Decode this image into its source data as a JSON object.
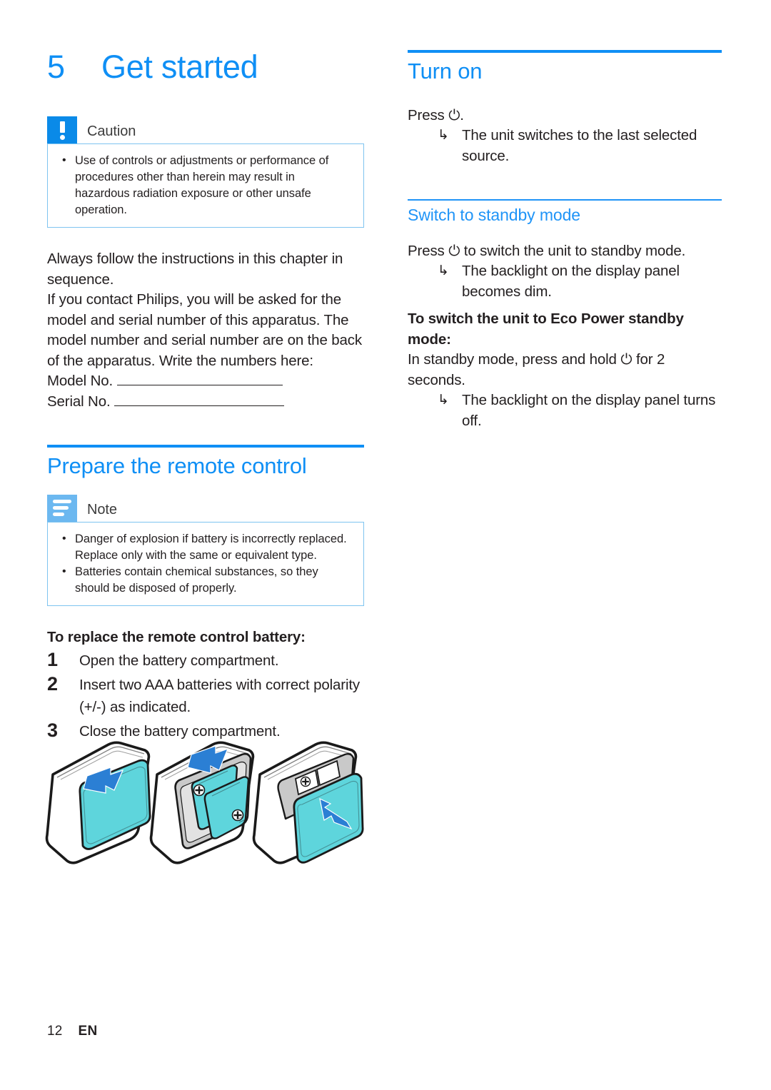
{
  "document": {
    "chapter_number": "5",
    "chapter_title": "Get started"
  },
  "left_column": {
    "caution": {
      "label": "Caution",
      "icon": "exclamation-icon",
      "items": [
        "Use of controls or adjustments or performance of procedures other than herein may result in hazardous radiation exposure or other unsafe operation."
      ]
    },
    "intro_paragraph_1": "Always follow the instructions in this chapter in sequence.",
    "intro_paragraph_2": "If you contact Philips, you will be asked for the model and serial number of this apparatus. The model number and serial number are on the back of the apparatus. Write the numbers here:",
    "model_label": "Model No.",
    "serial_label": "Serial No.",
    "prepare_section": {
      "title": "Prepare the remote control",
      "note": {
        "label": "Note",
        "icon": "note-lines-icon",
        "items": [
          "Danger of explosion if battery is incorrectly replaced. Replace only with the same or equivalent type.",
          "Batteries contain chemical substances, so they should be disposed of properly."
        ]
      },
      "steps_lead": "To replace the remote control battery:",
      "steps": [
        {
          "number": "1",
          "text": "Open the battery compartment."
        },
        {
          "number": "2",
          "text": "Insert two AAA batteries with correct polarity (+/-) as indicated."
        },
        {
          "number": "3",
          "text": "Close the battery compartment."
        }
      ],
      "figure_caption": ""
    }
  },
  "right_column": {
    "turn_on": {
      "title": "Turn on",
      "instruction": "Press ⏻.",
      "results": [
        "The unit switches to the last selected source."
      ]
    },
    "standby": {
      "title": "Switch to standby mode",
      "instruction": "Press ⏻ to switch the unit to standby mode.",
      "results": [
        "The backlight on the display panel becomes dim."
      ],
      "eco_heading": "To switch the unit to Eco Power standby mode:",
      "eco_instruction": "In standby mode, press and hold ⏻ for 2 seconds.",
      "eco_results": [
        "The backlight on the display panel turns off."
      ]
    }
  },
  "footer": {
    "page_number": "12",
    "language": "EN"
  },
  "glyphs": {
    "arrow": "↳",
    "bullet": "•"
  },
  "colors": {
    "heading_blue": "#0f8ff5",
    "subheading_blue": "#1f94f7",
    "caution_icon_blue": "#0a8ae8",
    "note_icon_blue": "#6cb8f0",
    "callout_border": "#7ec4f0",
    "body_text": "#231f20",
    "figure_teal": "#5ed5dc",
    "figure_arrow_blue": "#2b7fd4",
    "figure_gray": "#c9c9c9"
  }
}
